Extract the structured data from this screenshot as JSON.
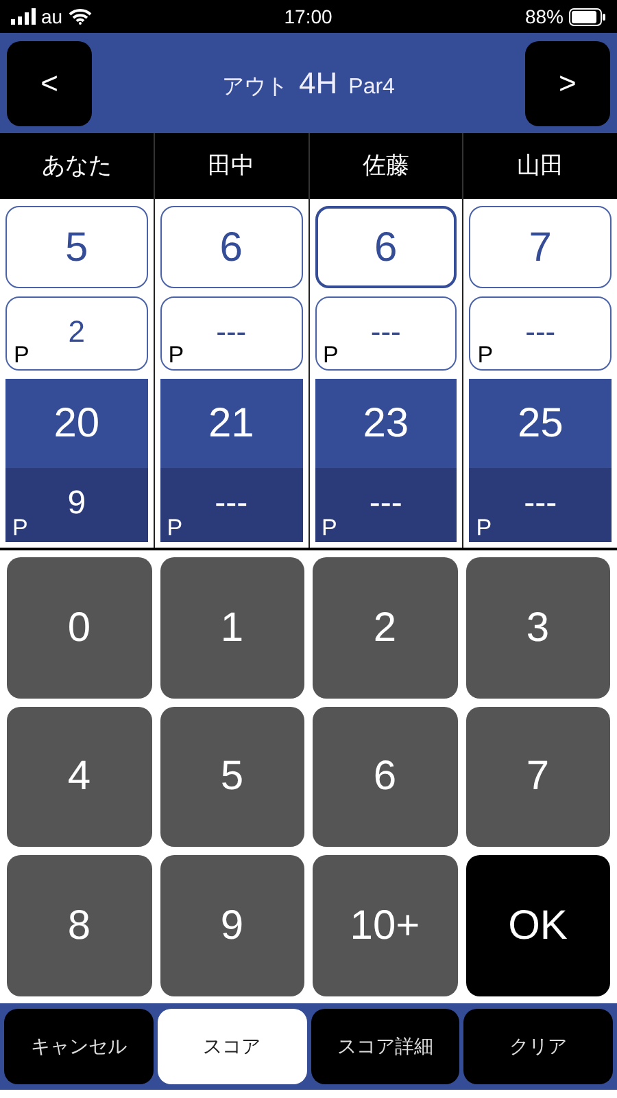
{
  "status_bar": {
    "carrier": "au",
    "time": "17:00",
    "battery": "88%"
  },
  "header": {
    "prev": "<",
    "next": ">",
    "course": "アウト",
    "hole": "4H",
    "par": "Par4"
  },
  "players": [
    {
      "name": "あなた",
      "score": "5",
      "putt_label": "P",
      "putt": "2",
      "total": "20",
      "total_putt_label": "P",
      "total_putt": "9",
      "selected": false
    },
    {
      "name": "田中",
      "score": "6",
      "putt_label": "P",
      "putt": "---",
      "total": "21",
      "total_putt_label": "P",
      "total_putt": "---",
      "selected": false
    },
    {
      "name": "佐藤",
      "score": "6",
      "putt_label": "P",
      "putt": "---",
      "total": "23",
      "total_putt_label": "P",
      "total_putt": "---",
      "selected": true
    },
    {
      "name": "山田",
      "score": "7",
      "putt_label": "P",
      "putt": "---",
      "total": "25",
      "total_putt_label": "P",
      "total_putt": "---",
      "selected": false
    }
  ],
  "keypad": [
    {
      "label": "0",
      "kind": "digit"
    },
    {
      "label": "1",
      "kind": "digit"
    },
    {
      "label": "2",
      "kind": "digit"
    },
    {
      "label": "3",
      "kind": "digit"
    },
    {
      "label": "4",
      "kind": "digit"
    },
    {
      "label": "5",
      "kind": "digit"
    },
    {
      "label": "6",
      "kind": "digit"
    },
    {
      "label": "7",
      "kind": "digit"
    },
    {
      "label": "8",
      "kind": "digit"
    },
    {
      "label": "9",
      "kind": "digit"
    },
    {
      "label": "10+",
      "kind": "digit"
    },
    {
      "label": "OK",
      "kind": "confirm"
    }
  ],
  "tabs": [
    {
      "label": "キャンセル",
      "selected": false
    },
    {
      "label": "スコア",
      "selected": true
    },
    {
      "label": "スコア詳細",
      "selected": false
    },
    {
      "label": "クリア",
      "selected": false
    }
  ]
}
